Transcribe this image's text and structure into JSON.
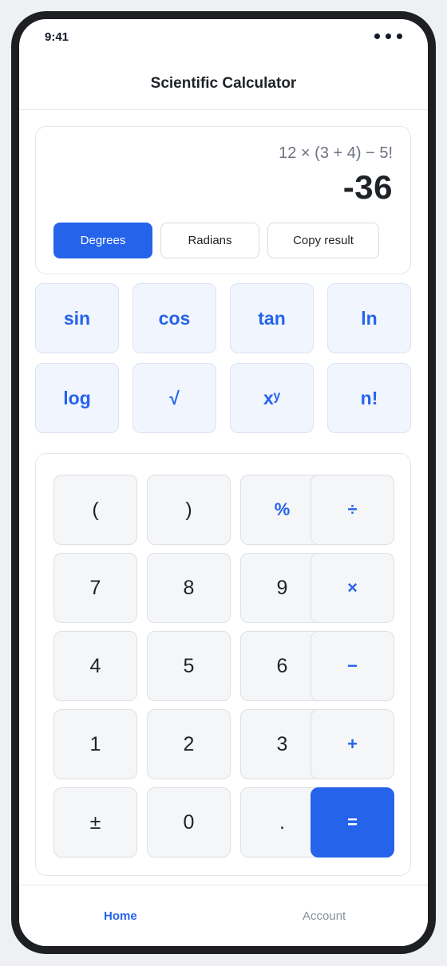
{
  "status_bar": {
    "time": "9:41"
  },
  "header": {
    "title": "Scientific Calculator"
  },
  "display": {
    "expression": "12 × (3 + 4) − 5!",
    "result": "-36"
  },
  "modes": {
    "degrees": "Degrees",
    "radians": "Radians",
    "copy": "Copy result",
    "active": "Degrees"
  },
  "functions": [
    "sin",
    "cos",
    "tan",
    "ln",
    "log",
    "√",
    "xʸ",
    "n!"
  ],
  "keypad": {
    "rows": [
      [
        "(",
        ")",
        "%",
        "÷"
      ],
      [
        "7",
        "8",
        "9",
        "×"
      ],
      [
        "4",
        "5",
        "6",
        "−"
      ],
      [
        "1",
        "2",
        "3",
        "+"
      ],
      [
        "±",
        "0",
        ".",
        "="
      ]
    ]
  },
  "tabs": {
    "home": "Home",
    "account": "Account",
    "active": "Home"
  },
  "colors": {
    "accent": "#2563eb",
    "text": "#1f2328",
    "muted": "#6b7280"
  }
}
